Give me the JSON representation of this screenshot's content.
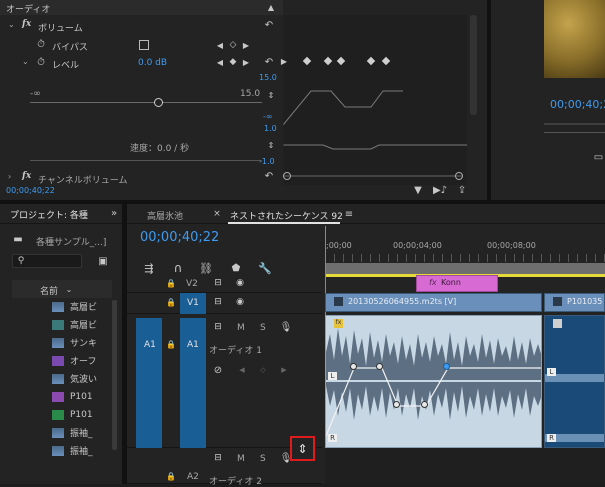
{
  "effect_panel": {
    "audio_header": "オーディオ",
    "volume_label": "ボリューム",
    "bypass_label": "バイパス",
    "level_label": "レベル",
    "level_value": "0.0 dB",
    "slider_min": "-∞",
    "slider_max": "15.0",
    "graph_top": "15.0",
    "graph_mid": "-∞",
    "graph_vel_top": "1.0",
    "graph_vel_bottom": "-1.0",
    "speed_label": "速度：0.0 / 秒",
    "channel_volume_label": "チャンネルボリューム",
    "timecode": "00;00;40;22"
  },
  "preview": {
    "timecode": "00;00;40;2"
  },
  "project_panel": {
    "title": "プロジェクト: 各種",
    "bin_name": "各種サンプル_...]",
    "column_name": "名前",
    "items": [
      "高層ビ",
      "高層ビ",
      "サンキ",
      "オーフ",
      "気波い",
      "P101",
      "P101",
      "振袖_",
      "振袖_"
    ]
  },
  "timeline": {
    "tab_inactive": "高層氷池",
    "tab_active": "ネストされたシーケンス 92",
    "timecode": "00;00;40;22",
    "ruler": [
      ";00;00",
      "00;00;04;00",
      "00;00;08;00"
    ],
    "tracks": {
      "v2": "V2",
      "v1": "V1",
      "a1": "A1",
      "a1_src": "A1",
      "a1_name": "オーディオ 1",
      "a2": "A2",
      "a2_name": "オーディオ 2",
      "m": "M",
      "s": "S"
    },
    "clips": {
      "fx_title": "Konn",
      "video_clip": "20130526064955.m2ts [V]",
      "video_clip_2": "P101035"
    }
  },
  "colors": {
    "accent": "#3e9bf0",
    "clip_audio": "#c8d7e4",
    "clip_video": "#6a8fba",
    "title_clip": "#d76ad3",
    "track_selected": "#1a5e96"
  }
}
